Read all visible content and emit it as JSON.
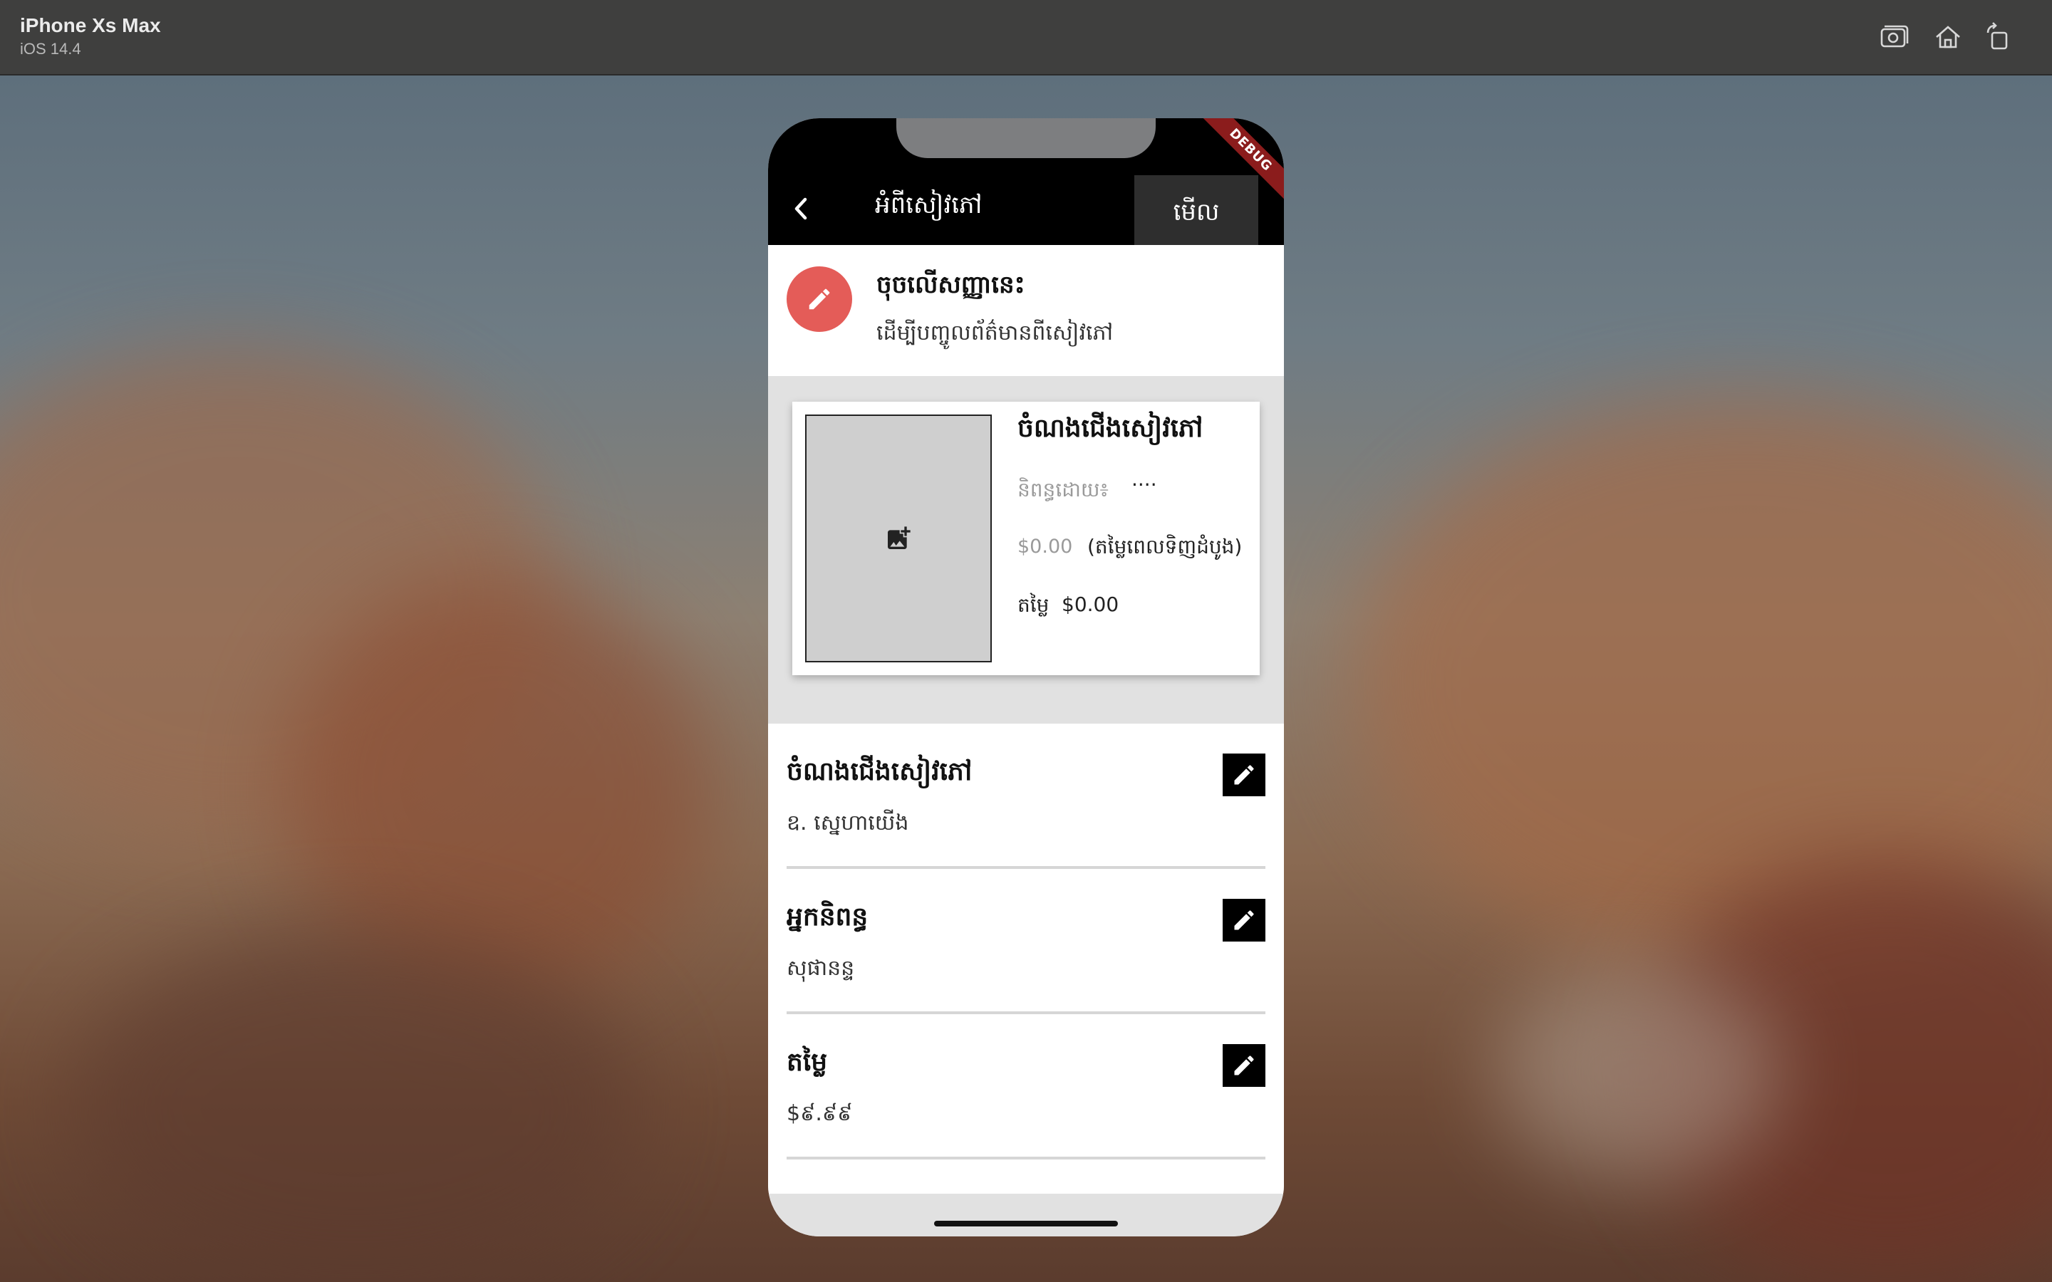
{
  "simulator": {
    "device": "iPhone Xs Max",
    "os": "iOS 14.4",
    "tools": [
      "screenshot-icon",
      "home-icon",
      "rotate-icon"
    ]
  },
  "app_bar": {
    "title": "អំពីសៀវភៅ",
    "view_button": "មើល",
    "debug_banner": "DEBUG"
  },
  "hint": {
    "title": "ចុចលើសញ្ញានេះ",
    "subtitle": "ដើម្បីបញ្ចូលព័ត៌មានពីសៀវភៅ"
  },
  "preview": {
    "title": "ចំណងជើងសៀវភៅ",
    "author_label": "និពន្ធដោយ៖",
    "author_value": "····",
    "original_price": "$0.00",
    "original_price_note": "(តម្លៃពេលទិញដំបូង)",
    "price_label": "តម្លៃ",
    "price_value": "$0.00"
  },
  "fields": [
    {
      "label": "ចំណងជើងសៀវភៅ",
      "value": "ឧ. ស្នេហាយើង"
    },
    {
      "label": "អ្នកនិពន្ធ",
      "value": "សុផានន្ទ"
    },
    {
      "label": "តម្លៃ",
      "value": "$៩.៩៩"
    }
  ],
  "colors": {
    "accent_fab": "#e45c58",
    "app_bar": "#000000",
    "debug": "#8b1c1c"
  }
}
